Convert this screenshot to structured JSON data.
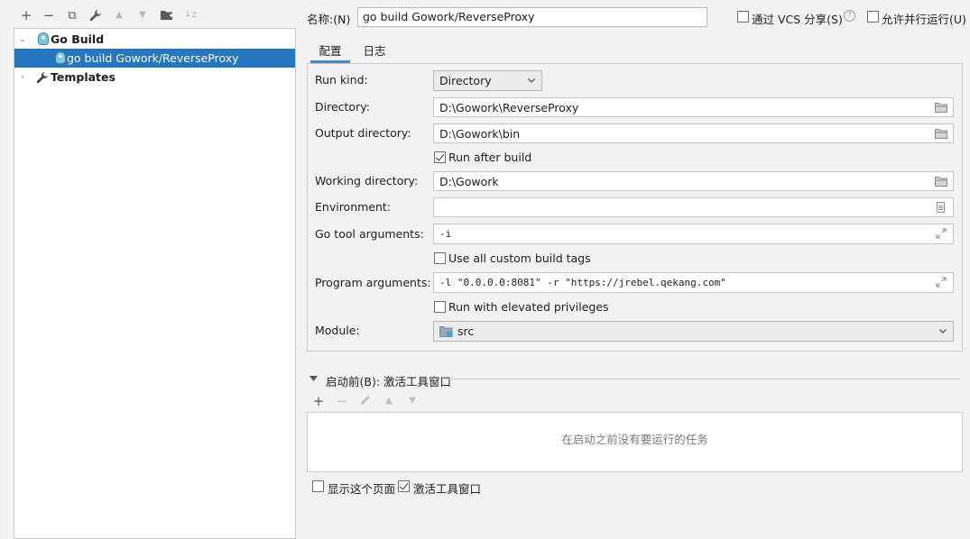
{
  "toolbar": {
    "add": "+",
    "remove": "−",
    "copy": "⧉",
    "edit": "🔧",
    "up": "▲",
    "down": "▼",
    "folder": "📁",
    "sort": "↓z"
  },
  "tree": {
    "group_label": "Go Build",
    "child_label": "go build Gowork/ReverseProxy",
    "templates_label": "Templates"
  },
  "header": {
    "name_label": "名称:(N)",
    "name_value": "go build Gowork/ReverseProxy",
    "vcs_label": "通过 VCS 分享(S)",
    "vcs_checked": false,
    "help_glyph": "?",
    "parallel_label": "允许并行运行(U)",
    "parallel_checked": false
  },
  "tabs": [
    {
      "label": "配置",
      "active": true
    },
    {
      "label": "日志",
      "active": false
    }
  ],
  "config": {
    "run_kind_label": "Run kind:",
    "run_kind_value": "Directory",
    "directory_label": "Directory:",
    "directory_value": "D:\\Gowork\\ReverseProxy",
    "output_label": "Output directory:",
    "output_value": "D:\\Gowork\\bin",
    "run_after_build_label": "Run after build",
    "run_after_build_checked": true,
    "working_dir_label": "Working directory:",
    "working_dir_value": "D:\\Gowork",
    "environment_label": "Environment:",
    "environment_value": "",
    "go_tool_args_label": "Go tool arguments:",
    "go_tool_args_value": "-i",
    "custom_tags_label": "Use all custom build tags",
    "custom_tags_checked": false,
    "program_args_label": "Program arguments:",
    "program_args_value": "-l \"0.0.0.0:8081\" -r \"https://jrebel.qekang.com\"",
    "elevated_label": "Run with elevated privileges",
    "elevated_checked": false,
    "module_label": "Module:",
    "module_value": "src"
  },
  "before_launch": {
    "title": "启动前(B): 激活工具窗口",
    "empty_message": "在启动之前没有要运行的任务"
  },
  "footer": {
    "show_page_label": "显示这个页面",
    "show_page_checked": false,
    "activate_tool_label": "激活工具窗口",
    "activate_tool_checked": true
  },
  "colors": {
    "selection": "#2675bf",
    "tab_underline": "#4a88c7",
    "background": "#f2f2f2"
  }
}
